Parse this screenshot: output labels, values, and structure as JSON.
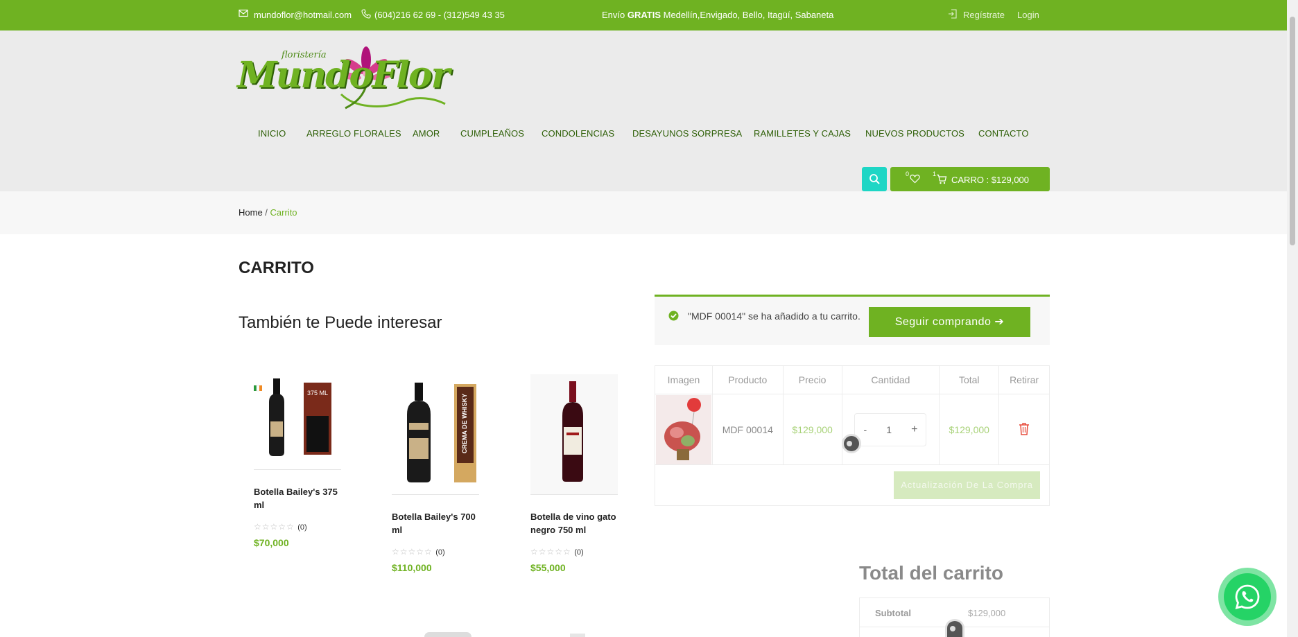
{
  "topbar": {
    "email": "mundoflor@hotmail.com",
    "phones": "(604)216 62 69 - (312)549 43 35",
    "shipping_prefix": "Envío ",
    "shipping_bold": "GRATIS",
    "shipping_rest": " Medellín,Envigado, Bello, Itagüí, Sabaneta",
    "register": "Regístrate",
    "login": "Login"
  },
  "logo": {
    "small": "floristería",
    "main": "MundoFlor"
  },
  "nav": [
    "INICIO",
    "ARREGLO FLORALES",
    "AMOR",
    "CUMPLEAÑOS",
    "CONDOLENCIAS",
    "DESAYUNOS SORPRESA",
    "RAMILLETES Y CAJAS",
    "NUEVOS PRODUCTOS",
    "CONTACTO"
  ],
  "header_cart": {
    "wishlist_count": "0",
    "cart_count": "1",
    "label": "CARRO : $129,000"
  },
  "breadcrumb": {
    "home": "Home",
    "sep": " / ",
    "current": "Carrito"
  },
  "page_title": "CARRITO",
  "related": {
    "title": "También te Puede interesar",
    "products": [
      {
        "name": "Botella Bailey's 375 ml",
        "rating": "☆☆☆☆☆",
        "reviews": "(0)",
        "price": "$70,000",
        "tag": "375 ML"
      },
      {
        "name": "Botella Bailey's 700 ml",
        "rating": "☆☆☆☆☆",
        "reviews": "(0)",
        "price": "$110,000",
        "tag": "CREMA DE WHISKY"
      },
      {
        "name": "Botella de vino gato negro 750 ml",
        "rating": "☆☆☆☆☆",
        "reviews": "(0)",
        "price": "$55,000",
        "tag": ""
      }
    ]
  },
  "notice": {
    "text": "\"MDF 00014\" se ha añadido a tu carrito.",
    "button": "Seguir comprando ➔"
  },
  "cart_table": {
    "headers": [
      "Imagen",
      "Producto",
      "Precio",
      "Cantidad",
      "Total",
      "Retirar"
    ],
    "row": {
      "product": "MDF 00014",
      "price": "$129,000",
      "minus": "-",
      "qty": "1",
      "plus": "+",
      "total": "$129,000"
    },
    "update_button": "Actualización De La Compra"
  },
  "totals": {
    "title": "Total del carrito",
    "subtotal_label": "Subtotal",
    "subtotal_value": "$129,000"
  },
  "colors": {
    "brand_green": "#6fb222",
    "dark_green": "#2e5f07",
    "search_teal": "#1ed6c5",
    "whatsapp": "#25d366",
    "remove_red": "#e74c3c"
  },
  "icons": [
    "mail-icon",
    "phone-icon",
    "login-icon",
    "search-icon",
    "heart-icon",
    "cart-icon",
    "check-circle-icon",
    "trash-icon",
    "whatsapp-icon"
  ]
}
